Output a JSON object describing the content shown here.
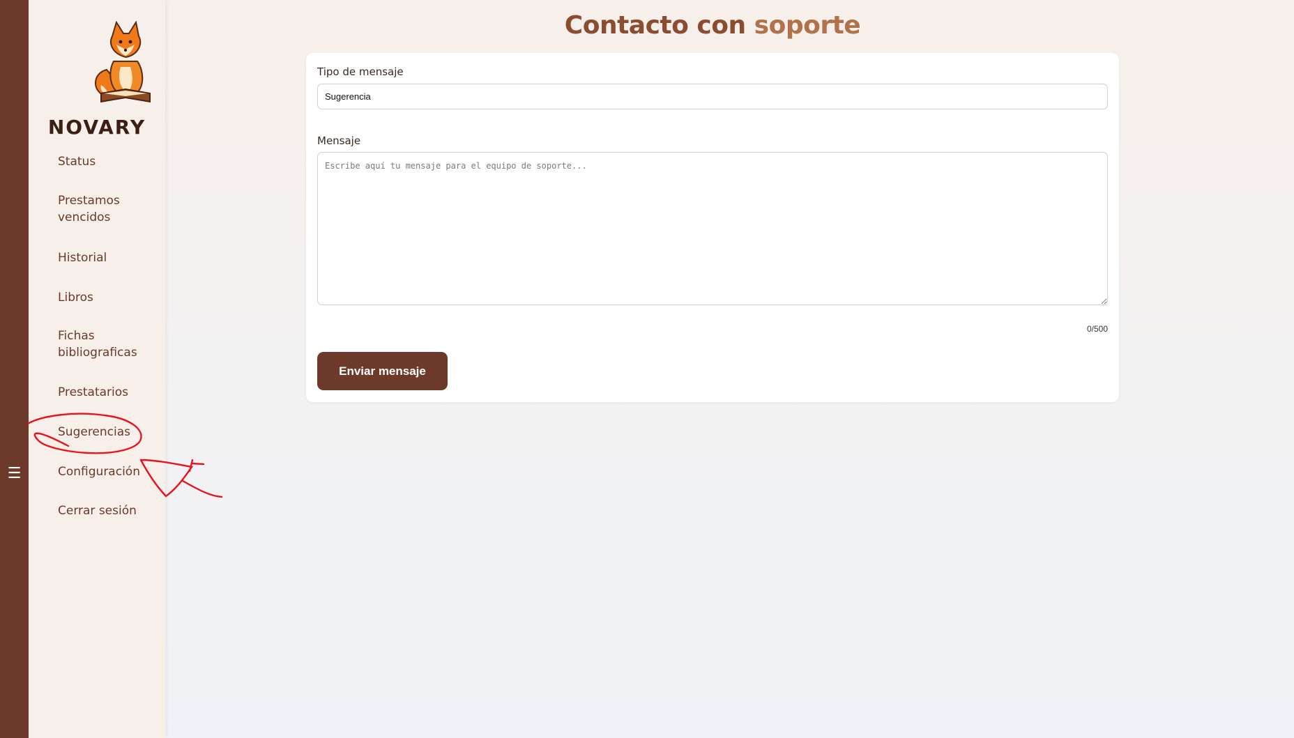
{
  "brand": {
    "name": "NOVARY"
  },
  "rail": {
    "toggle_icon": "menu-icon",
    "toggle_glyph": "☰",
    "color": "#6d3a2a"
  },
  "sidebar": {
    "items": [
      {
        "label": "Status"
      },
      {
        "label": "Prestamos vencidos"
      },
      {
        "label": "Historial"
      },
      {
        "label": "Libros"
      },
      {
        "label": "Fichas bibliograficas"
      },
      {
        "label": "Prestatarios"
      },
      {
        "label": "Sugerencias"
      },
      {
        "label": "Configuración"
      },
      {
        "label": "Cerrar sesión"
      }
    ]
  },
  "page": {
    "title_part1": "Contacto con",
    "title_part2": "soporte"
  },
  "form": {
    "type_label": "Tipo de mensaje",
    "type_value": "Sugerencia",
    "message_label": "Mensaje",
    "message_placeholder": "Escribe aquí tu mensaje para el equipo de soporte...",
    "counter": "0/500",
    "submit_label": "Enviar mensaje"
  },
  "colors": {
    "accent": "#6d3a2a",
    "title": "#8b4d31",
    "annotation": "#e8131d"
  }
}
